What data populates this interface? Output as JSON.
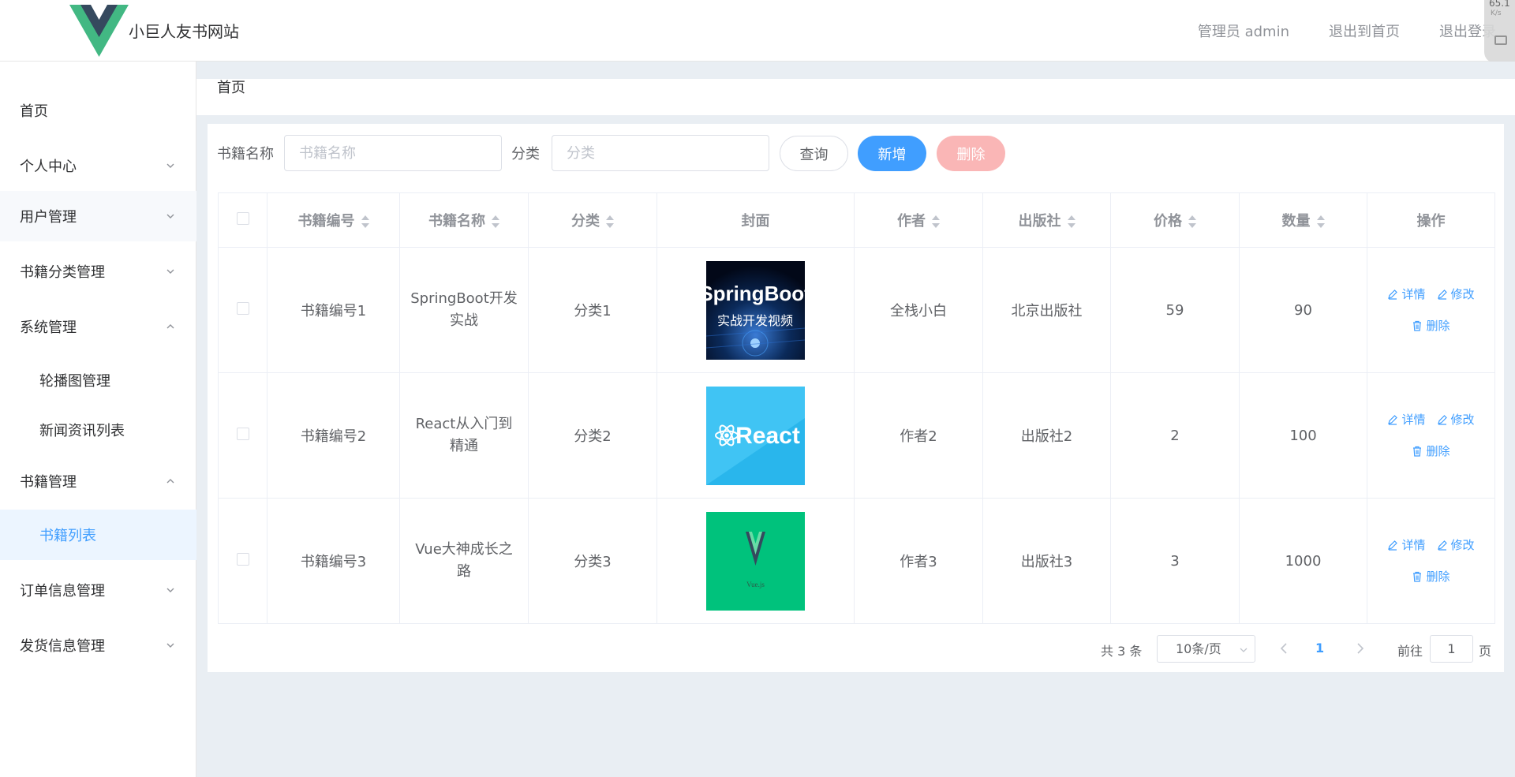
{
  "header": {
    "site_title": "小巨人友书网站",
    "user_label": "管理员 admin",
    "back_home": "退出到首页",
    "logout": "退出登录",
    "widget_speed": "65.1",
    "widget_unit": "K/s"
  },
  "sidebar": {
    "items": [
      {
        "label": "首页"
      },
      {
        "label": "个人中心"
      },
      {
        "label": "用户管理"
      },
      {
        "label": "书籍分类管理"
      },
      {
        "label": "系统管理"
      },
      {
        "label": "轮播图管理"
      },
      {
        "label": "新闻资讯列表"
      },
      {
        "label": "书籍管理"
      },
      {
        "label": "书籍列表"
      },
      {
        "label": "订单信息管理"
      },
      {
        "label": "发货信息管理"
      }
    ]
  },
  "breadcrumb": "首页",
  "search": {
    "name_label": "书籍名称",
    "name_placeholder": "书籍名称",
    "category_label": "分类",
    "category_placeholder": "分类",
    "query_btn": "查询",
    "add_btn": "新增",
    "delete_btn": "删除"
  },
  "table": {
    "headers": [
      "书籍编号",
      "书籍名称",
      "分类",
      "封面",
      "作者",
      "出版社",
      "价格",
      "数量",
      "操作"
    ],
    "rows": [
      {
        "id": "书籍编号1",
        "name": "SpringBoot开发实战",
        "category": "分类1",
        "cover_title": "SpringBoot",
        "cover_sub": "实战开发视频",
        "author": "全栈小白",
        "publisher": "北京出版社",
        "price": "59",
        "qty": "90"
      },
      {
        "id": "书籍编号2",
        "name": "React从入门到精通",
        "category": "分类2",
        "cover_title": "React",
        "cover_sub": "",
        "author": "作者2",
        "publisher": "出版社2",
        "price": "2",
        "qty": "100"
      },
      {
        "id": "书籍编号3",
        "name": "Vue大神成长之路",
        "category": "分类3",
        "cover_title": "Vue.js",
        "cover_sub": "",
        "author": "作者3",
        "publisher": "出版社3",
        "price": "3",
        "qty": "1000"
      }
    ],
    "op_detail": "详情",
    "op_edit": "修改",
    "op_delete": "删除"
  },
  "pagination": {
    "total": "共 3 条",
    "page_size": "10条/页",
    "current": "1",
    "goto_label": "前往",
    "goto_value": "1",
    "page_suffix": "页"
  },
  "colors": {
    "primary": "#409eff",
    "danger_disabled": "#fab6b6",
    "vue_green": "#42b883",
    "vue_dark": "#35495e"
  }
}
